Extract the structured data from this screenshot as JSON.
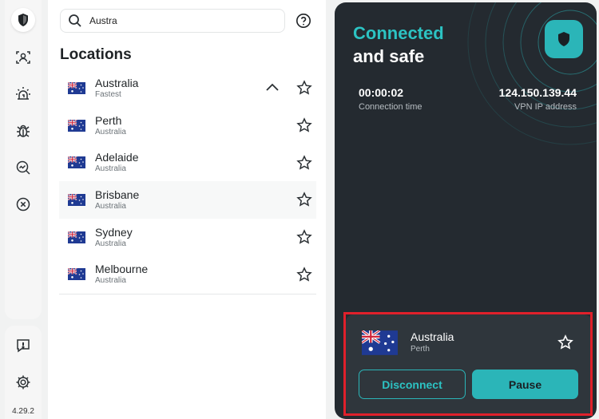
{
  "app": {
    "version": "4.29.2"
  },
  "rail": {
    "items": [
      {
        "icon": "shield-icon",
        "active": true
      },
      {
        "icon": "user-scan-icon"
      },
      {
        "icon": "alarm-icon"
      },
      {
        "icon": "bug-icon"
      },
      {
        "icon": "magnify-chart-icon"
      },
      {
        "icon": "close-circle-icon"
      }
    ],
    "bottom": [
      {
        "icon": "feedback-icon"
      },
      {
        "icon": "gear-icon"
      }
    ]
  },
  "search": {
    "value": "Austra",
    "icon": "search-icon",
    "help_icon": "help-icon"
  },
  "locations": {
    "title": "Locations",
    "items": [
      {
        "name": "Australia",
        "sub": "Fastest",
        "expanded": true
      },
      {
        "name": "Perth",
        "sub": "Australia"
      },
      {
        "name": "Adelaide",
        "sub": "Australia"
      },
      {
        "name": "Brisbane",
        "sub": "Australia"
      },
      {
        "name": "Sydney",
        "sub": "Australia"
      },
      {
        "name": "Melbourne",
        "sub": "Australia"
      }
    ]
  },
  "connection": {
    "status_line1": "Connected",
    "status_line2": "and safe",
    "time": "00:00:02",
    "time_label": "Connection time",
    "ip": "124.150.139.44",
    "ip_label": "VPN IP address",
    "country": "Australia",
    "city": "Perth",
    "disconnect_label": "Disconnect",
    "pause_label": "Pause"
  },
  "colors": {
    "accent": "#2bb5b8",
    "dark": "#242a30",
    "highlight": "#e0202b"
  }
}
